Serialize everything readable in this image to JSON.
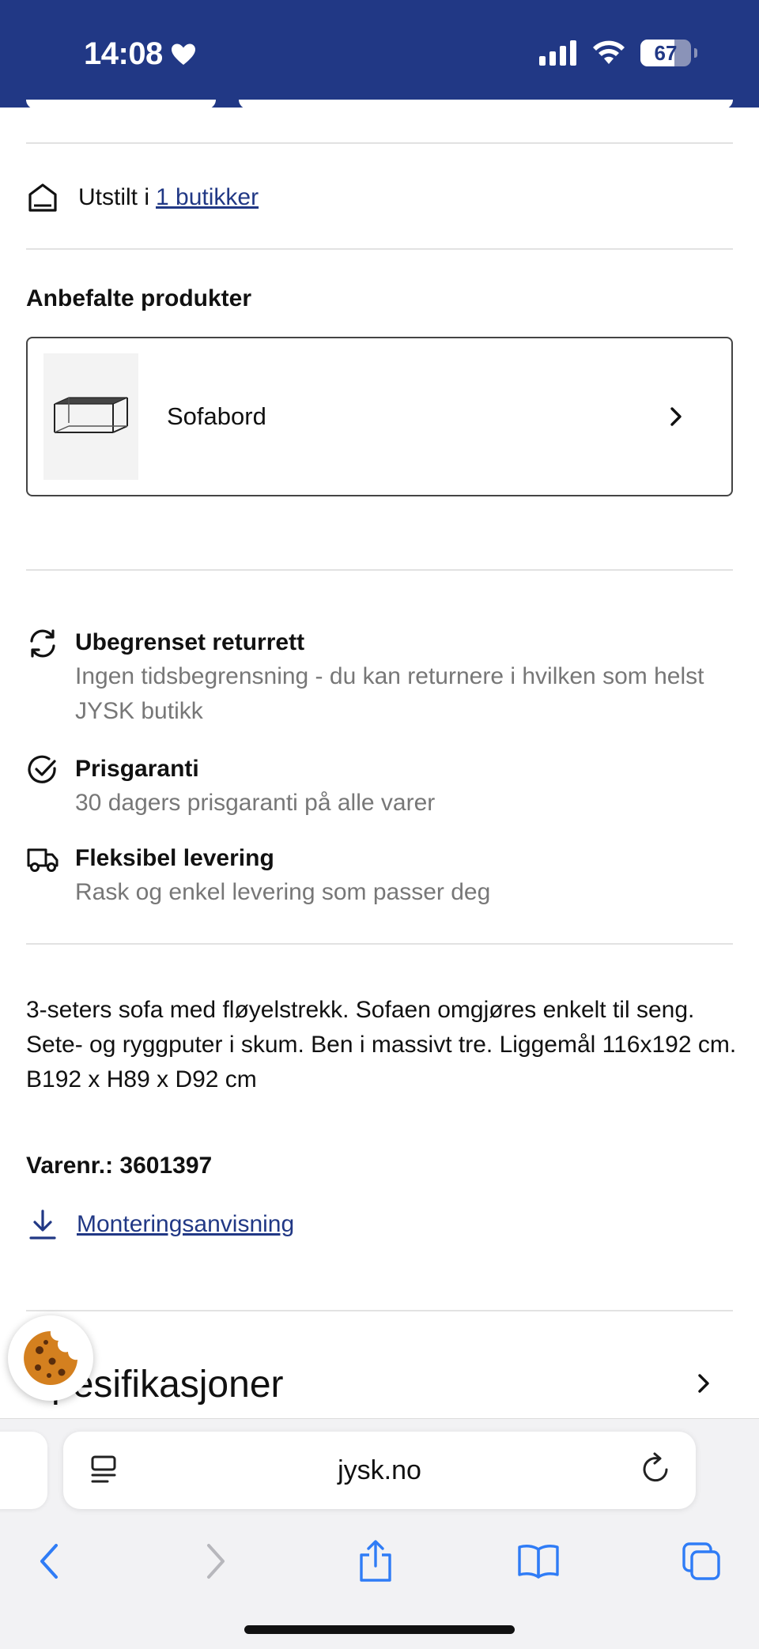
{
  "status_bar": {
    "time": "14:08",
    "battery_level": "67",
    "background_color": "#213885"
  },
  "store_availability": {
    "prefix": "Utstilt i ",
    "link_text": "1 butikker"
  },
  "recommended": {
    "heading": "Anbefalte produkter",
    "items": [
      {
        "label": "Sofabord"
      }
    ]
  },
  "usps": [
    {
      "icon": "refresh-icon",
      "title": "Ubegrenset returrett",
      "description": "Ingen tidsbegrensning - du kan returnere i hvilken som helst JYSK butikk"
    },
    {
      "icon": "check-circle-icon",
      "title": "Prisgaranti",
      "description": "30 dagers prisgaranti på alle varer"
    },
    {
      "icon": "truck-icon",
      "title": "Fleksibel levering",
      "description": "Rask og enkel levering som passer deg"
    }
  ],
  "product": {
    "description": "3-seters sofa med fløyelstrekk. Sofaen omgjøres enkelt til seng. Sete- og ryggputer i skum. Ben i massivt tre. Liggemål 116x192 cm. B192 x H89 x D92 cm",
    "item_number": "Varenr.: 3601397",
    "manual_link": "Monteringsanvisning"
  },
  "specifications": {
    "title": "Spesifikasjoner"
  },
  "browser": {
    "url": "jysk.no"
  },
  "colors": {
    "accent": "#213885",
    "muted_text": "#777777"
  }
}
